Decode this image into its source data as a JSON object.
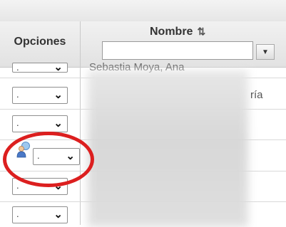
{
  "header": {
    "opciones_label": "Opciones",
    "nombre_label": "Nombre",
    "sort_icon": "⇅",
    "filter_placeholder": ""
  },
  "rows": [
    {
      "option": ".",
      "name": "Sebastia Moya, Ana"
    },
    {
      "option": ".",
      "name": "ría"
    },
    {
      "option": ".",
      "name": ""
    },
    {
      "option": ".",
      "name": ""
    },
    {
      "option": ".",
      "name": ""
    },
    {
      "option": ".",
      "name": ""
    }
  ],
  "icons": {
    "dropdown": "chevron-down-icon",
    "user": "user-icon"
  },
  "colors": {
    "highlight_ring": "#dc1f1f"
  }
}
